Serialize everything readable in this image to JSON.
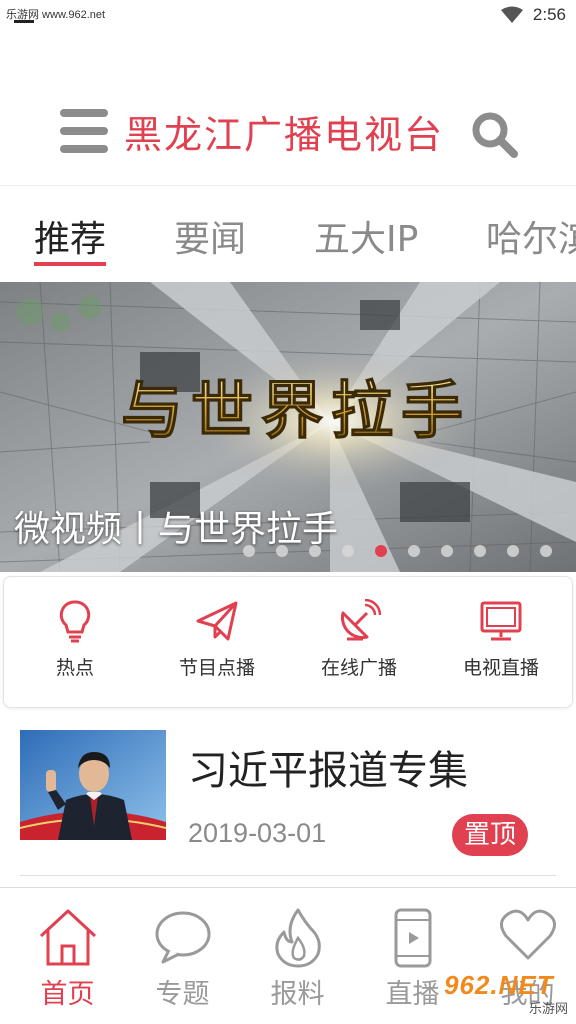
{
  "status_bar": {
    "source_text": "乐游网 www.962.net",
    "time": "2:56"
  },
  "header": {
    "title": "黑龙江广播电视台"
  },
  "tabs": [
    {
      "label": "推荐",
      "active": true
    },
    {
      "label": "要闻",
      "active": false
    },
    {
      "label": "五大IP",
      "active": false
    },
    {
      "label": "哈尔滨",
      "active": false
    }
  ],
  "banner": {
    "artwork_text": "与世界拉手",
    "caption": "微视频丨与世界拉手",
    "slide_count": 10,
    "active_slide": 5
  },
  "quick_actions": [
    {
      "label": "热点",
      "icon": "lightbulb-icon"
    },
    {
      "label": "节目点播",
      "icon": "paper-plane-icon"
    },
    {
      "label": "在线广播",
      "icon": "satellite-dish-icon"
    },
    {
      "label": "电视直播",
      "icon": "tv-icon"
    }
  ],
  "news": [
    {
      "title": "习近平报道专集",
      "date": "2019-03-01",
      "badge": "置顶"
    }
  ],
  "bottom_nav": [
    {
      "label": "首页",
      "icon": "home-icon",
      "active": true
    },
    {
      "label": "专题",
      "icon": "speech-bubble-icon",
      "active": false
    },
    {
      "label": "报料",
      "icon": "flame-icon",
      "active": false
    },
    {
      "label": "直播",
      "icon": "phone-play-icon",
      "active": false
    },
    {
      "label": "我的",
      "icon": "heart-icon",
      "active": false
    }
  ],
  "watermark": {
    "main": "962.NET",
    "sub": "乐游网"
  },
  "colors": {
    "accent": "#e0404f",
    "inactive_text": "#8a8a8a",
    "icon_gray": "#8c8c8c"
  }
}
